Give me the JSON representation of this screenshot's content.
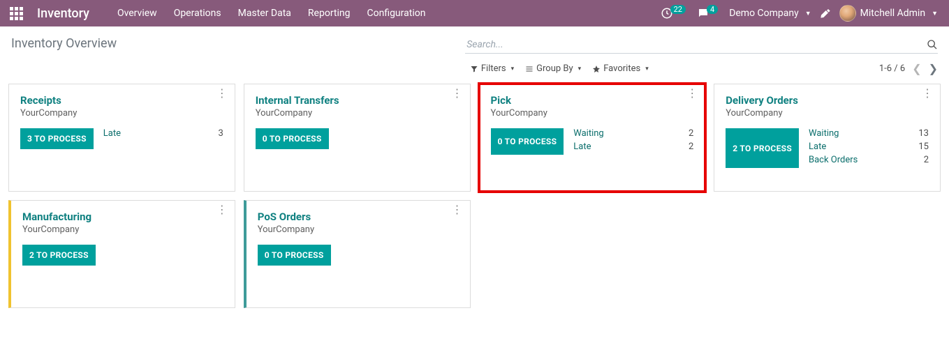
{
  "brand": "Inventory",
  "nav": [
    "Overview",
    "Operations",
    "Master Data",
    "Reporting",
    "Configuration"
  ],
  "timer_badge": "22",
  "chat_badge": "4",
  "company": "Demo Company",
  "user": "Mitchell Admin",
  "page_title": "Inventory Overview",
  "search": {
    "placeholder": "Search..."
  },
  "filters_label": "Filters",
  "groupby_label": "Group By",
  "favorites_label": "Favorites",
  "pager": {
    "range": "1-6 / 6"
  },
  "cards": [
    {
      "title": "Receipts",
      "subtitle": "YourCompany",
      "button": "3 TO PROCESS",
      "stats": [
        {
          "label": "Late",
          "value": "3"
        }
      ],
      "stripe": "",
      "highlight": false
    },
    {
      "title": "Internal Transfers",
      "subtitle": "YourCompany",
      "button": "0 TO PROCESS",
      "stats": [],
      "stripe": "",
      "highlight": false
    },
    {
      "title": "Pick",
      "subtitle": "YourCompany",
      "button": "0 TO PROCESS",
      "stats": [
        {
          "label": "Waiting",
          "value": "2"
        },
        {
          "label": "Late",
          "value": "2"
        }
      ],
      "stripe": "",
      "highlight": true
    },
    {
      "title": "Delivery Orders",
      "subtitle": "YourCompany",
      "button": "2 TO PROCESS",
      "stats": [
        {
          "label": "Waiting",
          "value": "13"
        },
        {
          "label": "Late",
          "value": "15"
        },
        {
          "label": "Back Orders",
          "value": "2"
        }
      ],
      "stripe": "",
      "highlight": false
    },
    {
      "title": "Manufacturing",
      "subtitle": "YourCompany",
      "button": "2 TO PROCESS",
      "stats": [],
      "stripe": "yellow",
      "highlight": false
    },
    {
      "title": "PoS Orders",
      "subtitle": "YourCompany",
      "button": "0 TO PROCESS",
      "stats": [],
      "stripe": "teal",
      "highlight": false
    }
  ]
}
